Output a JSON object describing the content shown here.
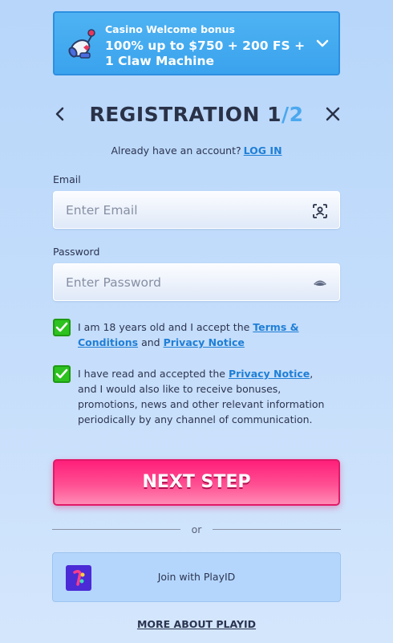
{
  "bonus": {
    "label": "Casino Welcome bonus",
    "text": "100% up to $750 + 200 FS + 1 Claw Machine",
    "icon": "gift-cannon-icon"
  },
  "header": {
    "title_main": "REGISTRATION 1",
    "title_sep": "/",
    "title_total": "2"
  },
  "account": {
    "prompt": "Already have an account?",
    "login_label": "LOG IN"
  },
  "email": {
    "label": "Email",
    "placeholder": "Enter Email"
  },
  "password": {
    "label": "Password",
    "placeholder": "Enter Password"
  },
  "consent_age": {
    "checked": true,
    "text_before": "I am 18 years old and I accept the ",
    "terms_link": "Terms & Conditions",
    "text_mid": " and ",
    "privacy_link": "Privacy Notice"
  },
  "consent_marketing": {
    "checked": true,
    "text_before": "I have read and accepted the ",
    "privacy_link": "Privacy Notice",
    "text_after": ", and I would also like to receive bonuses, promotions, news and other relevant information periodically by any channel of communication."
  },
  "next_label": "NEXT STEP",
  "divider_label": "or",
  "playid": {
    "label": "Join with PlayID",
    "more_label": "MORE ABOUT PLAYID"
  },
  "colors": {
    "accent": "#ff1f7a",
    "link": "#1f7fd6",
    "check": "#2dc21f",
    "banner": "#3aa3ee"
  }
}
